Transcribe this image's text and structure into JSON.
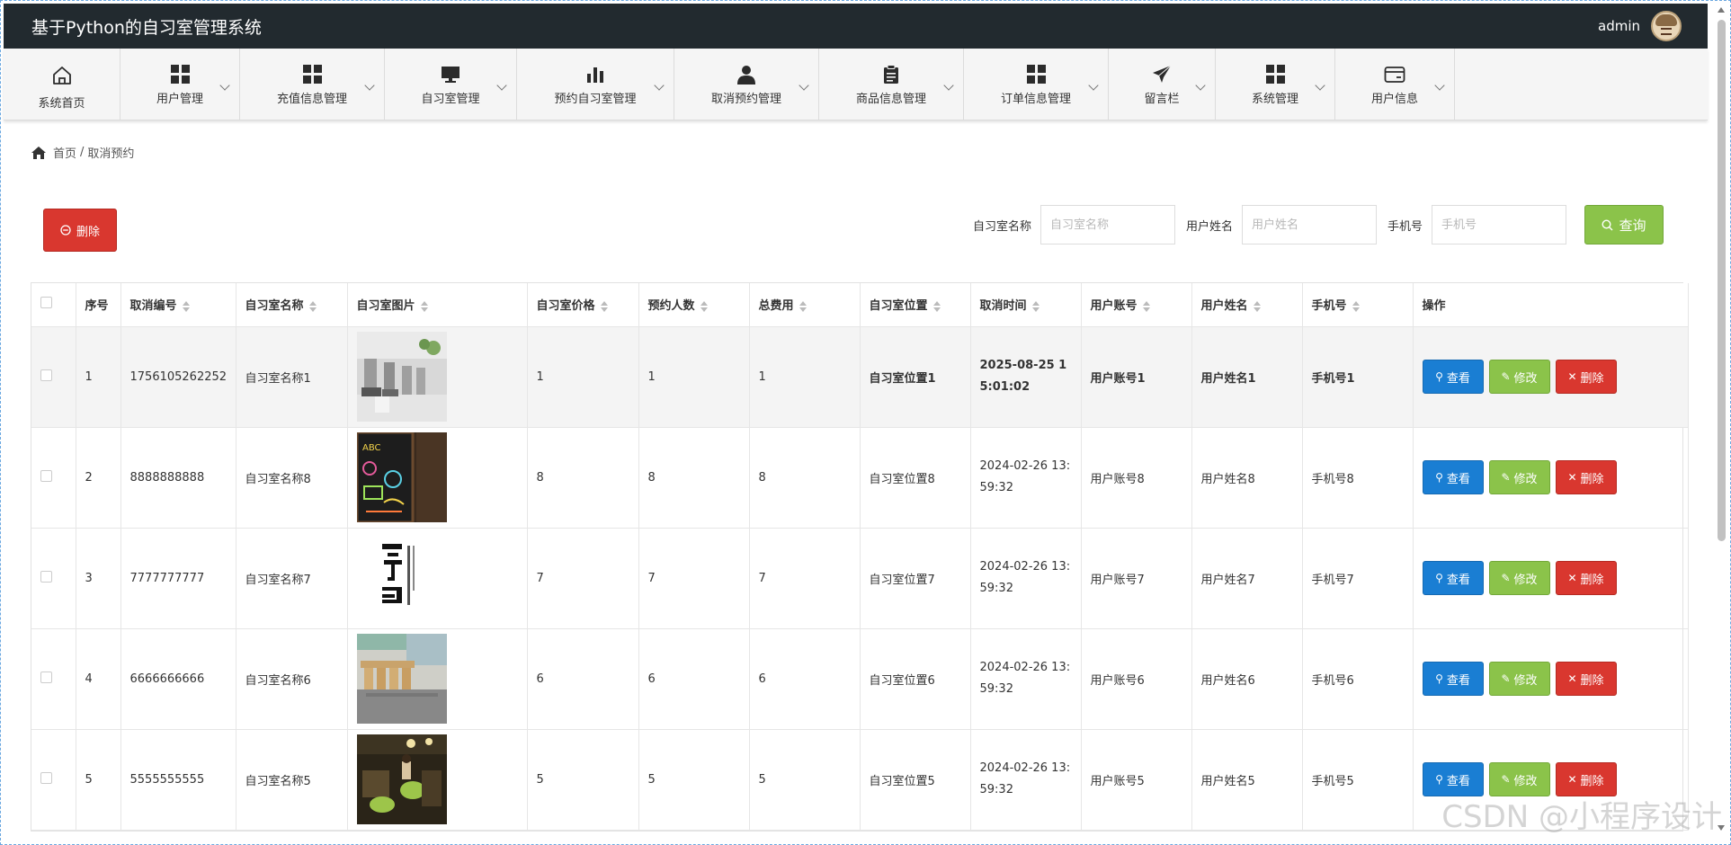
{
  "header": {
    "title": "基于Python的自习室管理系统",
    "username": "admin"
  },
  "nav": [
    {
      "label": "系统首页",
      "icon": "home-icon",
      "width": 130,
      "caret": false
    },
    {
      "label": "用户管理",
      "icon": "grid-icon",
      "width": 133,
      "caret": true
    },
    {
      "label": "充值信息管理",
      "icon": "grid-icon",
      "width": 161,
      "caret": true
    },
    {
      "label": "自习室管理",
      "icon": "monitor-icon",
      "width": 147,
      "caret": true
    },
    {
      "label": "预约自习室管理",
      "icon": "bar-chart-icon",
      "width": 175,
      "caret": true
    },
    {
      "label": "取消预约管理",
      "icon": "user-icon",
      "width": 161,
      "caret": true
    },
    {
      "label": "商品信息管理",
      "icon": "clipboard-icon",
      "width": 161,
      "caret": true
    },
    {
      "label": "订单信息管理",
      "icon": "grid-icon",
      "width": 161,
      "caret": true
    },
    {
      "label": "留言栏",
      "icon": "send-icon",
      "width": 119,
      "caret": true
    },
    {
      "label": "系统管理",
      "icon": "grid-icon",
      "width": 133,
      "caret": true
    },
    {
      "label": "用户信息",
      "icon": "card-icon",
      "width": 133,
      "caret": true
    }
  ],
  "breadcrumb": {
    "home": "首页",
    "separator": "/",
    "current": "取消预约"
  },
  "toolbar": {
    "delete_label": "删除"
  },
  "search": {
    "fields": [
      {
        "label": "自习室名称",
        "placeholder": "自习室名称"
      },
      {
        "label": "用户姓名",
        "placeholder": "用户姓名"
      },
      {
        "label": "手机号",
        "placeholder": "手机号"
      }
    ],
    "button": "查询"
  },
  "table": {
    "columns": [
      "序号",
      "取消编号",
      "自习室名称",
      "自习室图片",
      "自习室价格",
      "预约人数",
      "总费用",
      "自习室位置",
      "取消时间",
      "用户账号",
      "用户姓名",
      "手机号",
      "操作"
    ],
    "sortable": [
      false,
      true,
      true,
      true,
      true,
      true,
      true,
      true,
      true,
      true,
      true,
      true,
      false
    ],
    "actions": {
      "view": "查看",
      "edit": "修改",
      "delete": "删除"
    },
    "rows": [
      {
        "idx": "1",
        "code": "1756105262252",
        "name": "自习室名称1",
        "price": "1",
        "people": "1",
        "total": "1",
        "location": "自习室位置1",
        "time": "2025-08-25 15:01:02",
        "account": "用户账号1",
        "uname": "用户姓名1",
        "phone": "手机号1",
        "bold": true,
        "highlight": true,
        "img": "desks"
      },
      {
        "idx": "2",
        "code": "8888888888",
        "name": "自习室名称8",
        "price": "8",
        "people": "8",
        "total": "8",
        "location": "自习室位置8",
        "time": "2024-02-26 13:59:32",
        "account": "用户账号8",
        "uname": "用户姓名8",
        "phone": "手机号8",
        "bold": false,
        "highlight": false,
        "img": "chalkboard"
      },
      {
        "idx": "3",
        "code": "7777777777",
        "name": "自习室名称7",
        "price": "7",
        "people": "7",
        "total": "7",
        "location": "自习室位置7",
        "time": "2024-02-26 13:59:32",
        "account": "用户账号7",
        "uname": "用户姓名7",
        "phone": "手机号7",
        "bold": false,
        "highlight": false,
        "img": "poster"
      },
      {
        "idx": "4",
        "code": "6666666666",
        "name": "自习室名称6",
        "price": "6",
        "people": "6",
        "total": "6",
        "location": "自习室位置6",
        "time": "2024-02-26 13:59:32",
        "account": "用户账号6",
        "uname": "用户姓名6",
        "phone": "手机号6",
        "bold": false,
        "highlight": false,
        "img": "chairs"
      },
      {
        "idx": "5",
        "code": "5555555555",
        "name": "自习室名称5",
        "price": "5",
        "people": "5",
        "total": "5",
        "location": "自习室位置5",
        "time": "2024-02-26 13:59:32",
        "account": "用户账号5",
        "uname": "用户姓名5",
        "phone": "手机号5",
        "bold": false,
        "highlight": false,
        "img": "cafe"
      }
    ]
  },
  "watermark": "CSDN @小程序设计"
}
